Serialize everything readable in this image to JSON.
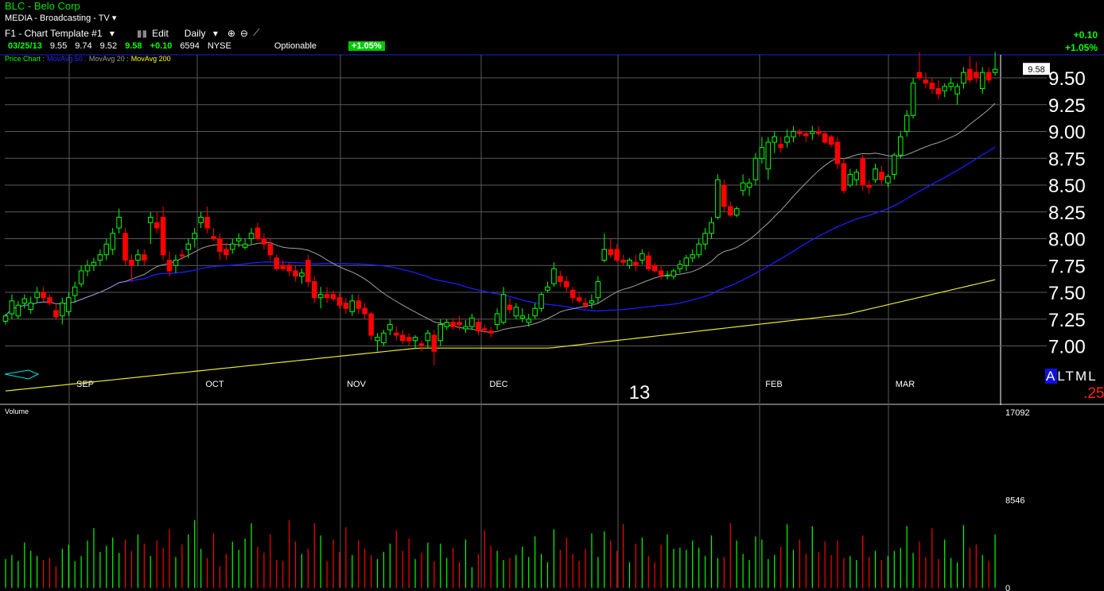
{
  "header": {
    "symbol_title": "BLC - Belo Corp",
    "sector": "MEDIA - Broadcasting - TV",
    "template": "F1 - Chart Template #1",
    "edit_label": "Edit",
    "period": "Daily",
    "optionable": "Optionable",
    "pct_badge": "+1.05%"
  },
  "quote": {
    "date": "03/25/13",
    "open": "9.55",
    "high": "9.74",
    "low": "9.52",
    "last": "9.58",
    "change": "+0.10",
    "volume": "6594",
    "exchange": "NYSE"
  },
  "summary": {
    "change": "+0.10",
    "pct": "+1.05%"
  },
  "legend": [
    {
      "text": "Price Chart :",
      "color": "#00ff00"
    },
    {
      "text": "MovAvg 50 :",
      "color": "#2828ff"
    },
    {
      "text": "MovAvg 20 :",
      "color": "#9a9a9a"
    },
    {
      "text": "MovAvg 200",
      "color": "#ffff00"
    }
  ],
  "colors": {
    "up": "#00ff00",
    "down": "#ff0000",
    "grid": "#5a5a5a",
    "ma20": "#a0a0a0",
    "ma50": "#1c1cff",
    "ma200": "#e8e830",
    "border": "#2020d0"
  },
  "volume_panel": {
    "label": "Volume",
    "ticks": [
      "17092",
      "8546",
      "0"
    ],
    "max": 17092
  },
  "timeframe": {
    "options": [
      "A",
      "L",
      "T",
      "M",
      "L"
    ],
    "selected": "A",
    "offset": ".25"
  },
  "year_label": "13",
  "chart_data": {
    "type": "candlestick",
    "ylim": [
      6.5,
      9.62
    ],
    "y_ticks": [
      "9.50",
      "9.25",
      "9.00",
      "8.75",
      "8.50",
      "8.25",
      "8.00",
      "7.75",
      "7.50",
      "7.25",
      "7.00"
    ],
    "x_ticks": [
      "SEP",
      "OCT",
      "NOV",
      "DEC",
      "FEB",
      "MAR"
    ],
    "last_price_label": "9.58",
    "candles": [
      [
        7.23,
        7.3,
        7.2,
        7.28
      ],
      [
        7.3,
        7.48,
        7.25,
        7.42
      ],
      [
        7.28,
        7.42,
        7.25,
        7.38
      ],
      [
        7.4,
        7.48,
        7.35,
        7.44
      ],
      [
        7.34,
        7.46,
        7.3,
        7.4
      ],
      [
        7.45,
        7.55,
        7.4,
        7.5
      ],
      [
        7.5,
        7.55,
        7.42,
        7.45
      ],
      [
        7.45,
        7.48,
        7.38,
        7.4
      ],
      [
        7.33,
        7.4,
        7.25,
        7.27
      ],
      [
        7.28,
        7.45,
        7.2,
        7.4
      ],
      [
        7.32,
        7.5,
        7.28,
        7.45
      ],
      [
        7.47,
        7.6,
        7.4,
        7.55
      ],
      [
        7.58,
        7.75,
        7.55,
        7.7
      ],
      [
        7.7,
        7.8,
        7.65,
        7.75
      ],
      [
        7.75,
        7.82,
        7.7,
        7.78
      ],
      [
        7.8,
        7.9,
        7.75,
        7.85
      ],
      [
        7.85,
        8.0,
        7.8,
        7.95
      ],
      [
        7.9,
        8.1,
        7.85,
        8.05
      ],
      [
        8.1,
        8.28,
        8.05,
        8.2
      ],
      [
        8.05,
        8.1,
        7.75,
        7.8
      ],
      [
        7.8,
        7.85,
        7.6,
        7.75
      ],
      [
        7.8,
        7.9,
        7.75,
        7.85
      ],
      [
        7.85,
        7.9,
        7.75,
        7.8
      ],
      [
        8.15,
        8.25,
        7.95,
        8.2
      ],
      [
        8.15,
        8.25,
        8.05,
        8.1
      ],
      [
        8.2,
        8.3,
        7.8,
        7.85
      ],
      [
        7.8,
        7.88,
        7.65,
        7.7
      ],
      [
        7.75,
        7.85,
        7.68,
        7.8
      ],
      [
        7.85,
        7.9,
        7.8,
        7.84
      ],
      [
        7.9,
        8.0,
        7.82,
        7.95
      ],
      [
        8.0,
        8.1,
        7.92,
        8.05
      ],
      [
        8.15,
        8.25,
        8.1,
        8.2
      ],
      [
        8.2,
        8.3,
        8.05,
        8.1
      ],
      [
        8.02,
        8.1,
        7.98,
        8.0
      ],
      [
        8.0,
        8.05,
        7.8,
        7.88
      ],
      [
        7.9,
        7.96,
        7.8,
        7.85
      ],
      [
        7.9,
        8.0,
        7.86,
        7.95
      ],
      [
        7.98,
        8.05,
        7.92,
        8.0
      ],
      [
        7.92,
        8.0,
        7.9,
        7.95
      ],
      [
        8.0,
        8.1,
        7.95,
        8.05
      ],
      [
        8.1,
        8.15,
        7.98,
        8.0
      ],
      [
        8.0,
        8.05,
        7.9,
        7.95
      ],
      [
        7.95,
        8.0,
        7.8,
        7.85
      ],
      [
        7.82,
        7.85,
        7.7,
        7.72
      ],
      [
        7.75,
        7.8,
        7.7,
        7.72
      ],
      [
        7.75,
        7.78,
        7.65,
        7.7
      ],
      [
        7.7,
        7.75,
        7.6,
        7.65
      ],
      [
        7.65,
        7.72,
        7.58,
        7.68
      ],
      [
        7.8,
        7.85,
        7.55,
        7.6
      ],
      [
        7.6,
        7.65,
        7.4,
        7.45
      ],
      [
        7.45,
        7.55,
        7.35,
        7.48
      ],
      [
        7.48,
        7.55,
        7.4,
        7.45
      ],
      [
        7.48,
        7.52,
        7.42,
        7.44
      ],
      [
        7.45,
        7.5,
        7.35,
        7.38
      ],
      [
        7.4,
        7.45,
        7.3,
        7.35
      ],
      [
        7.32,
        7.48,
        7.28,
        7.42
      ],
      [
        7.42,
        7.48,
        7.3,
        7.35
      ],
      [
        7.35,
        7.4,
        7.25,
        7.3
      ],
      [
        7.3,
        7.32,
        7.05,
        7.1
      ],
      [
        7.05,
        7.12,
        6.95,
        7.08
      ],
      [
        7.03,
        7.15,
        7.0,
        7.12
      ],
      [
        7.15,
        7.25,
        7.1,
        7.2
      ],
      [
        7.12,
        7.18,
        7.05,
        7.1
      ],
      [
        7.1,
        7.15,
        7.02,
        7.05
      ],
      [
        7.08,
        7.12,
        7.0,
        7.05
      ],
      [
        7.05,
        7.1,
        6.98,
        7.08
      ],
      [
        7.02,
        7.05,
        6.95,
        7.0
      ],
      [
        7.05,
        7.15,
        6.98,
        7.12
      ],
      [
        7.1,
        7.15,
        6.82,
        6.95
      ],
      [
        7.05,
        7.25,
        7.0,
        7.2
      ],
      [
        7.18,
        7.25,
        7.15,
        7.22
      ],
      [
        7.22,
        7.26,
        7.15,
        7.18
      ],
      [
        7.22,
        7.28,
        7.15,
        7.2
      ],
      [
        7.16,
        7.24,
        7.12,
        7.18
      ],
      [
        7.18,
        7.3,
        7.15,
        7.26
      ],
      [
        7.22,
        7.25,
        7.1,
        7.14
      ],
      [
        7.16,
        7.2,
        7.12,
        7.15
      ],
      [
        7.14,
        7.18,
        7.08,
        7.12
      ],
      [
        7.2,
        7.35,
        7.15,
        7.3
      ],
      [
        7.22,
        7.55,
        7.2,
        7.48
      ],
      [
        7.38,
        7.45,
        7.3,
        7.34
      ],
      [
        7.28,
        7.4,
        7.25,
        7.36
      ],
      [
        7.26,
        7.35,
        7.22,
        7.28
      ],
      [
        7.22,
        7.3,
        7.18,
        7.25
      ],
      [
        7.28,
        7.4,
        7.25,
        7.35
      ],
      [
        7.35,
        7.5,
        7.32,
        7.48
      ],
      [
        7.52,
        7.6,
        7.5,
        7.55
      ],
      [
        7.58,
        7.78,
        7.55,
        7.72
      ],
      [
        7.65,
        7.7,
        7.55,
        7.6
      ],
      [
        7.6,
        7.65,
        7.5,
        7.55
      ],
      [
        7.52,
        7.55,
        7.4,
        7.45
      ],
      [
        7.45,
        7.5,
        7.4,
        7.42
      ],
      [
        7.4,
        7.45,
        7.35,
        7.38
      ],
      [
        7.4,
        7.48,
        7.35,
        7.42
      ],
      [
        7.45,
        7.65,
        7.4,
        7.6
      ],
      [
        7.8,
        8.05,
        7.78,
        7.9
      ],
      [
        7.9,
        8.0,
        7.82,
        7.85
      ],
      [
        7.9,
        7.95,
        7.78,
        7.8
      ],
      [
        7.8,
        7.85,
        7.75,
        7.78
      ],
      [
        7.75,
        7.82,
        7.72,
        7.8
      ],
      [
        7.78,
        7.85,
        7.7,
        7.75
      ],
      [
        7.8,
        7.9,
        7.76,
        7.86
      ],
      [
        7.84,
        7.88,
        7.7,
        7.72
      ],
      [
        7.75,
        7.78,
        7.68,
        7.7
      ],
      [
        7.7,
        7.75,
        7.62,
        7.66
      ],
      [
        7.66,
        7.7,
        7.62,
        7.66
      ],
      [
        7.65,
        7.72,
        7.62,
        7.7
      ],
      [
        7.72,
        7.8,
        7.68,
        7.76
      ],
      [
        7.75,
        7.85,
        7.7,
        7.82
      ],
      [
        7.82,
        7.9,
        7.78,
        7.85
      ],
      [
        7.85,
        8.0,
        7.82,
        7.95
      ],
      [
        7.95,
        8.1,
        7.9,
        8.05
      ],
      [
        8.05,
        8.2,
        8.0,
        8.15
      ],
      [
        8.2,
        8.6,
        8.18,
        8.55
      ],
      [
        8.5,
        8.55,
        8.25,
        8.3
      ],
      [
        8.3,
        8.35,
        8.2,
        8.22
      ],
      [
        8.22,
        8.3,
        8.2,
        8.28
      ],
      [
        8.45,
        8.6,
        8.4,
        8.52
      ],
      [
        8.48,
        8.56,
        8.4,
        8.52
      ],
      [
        8.55,
        8.8,
        8.5,
        8.75
      ],
      [
        8.75,
        8.95,
        8.7,
        8.85
      ],
      [
        8.65,
        8.95,
        8.55,
        8.9
      ],
      [
        8.9,
        9.0,
        8.8,
        8.95
      ],
      [
        8.88,
        8.95,
        8.8,
        8.85
      ],
      [
        8.9,
        9.02,
        8.85,
        8.95
      ],
      [
        8.95,
        9.05,
        8.9,
        9.0
      ],
      [
        9.0,
        9.02,
        8.95,
        8.98
      ],
      [
        8.98,
        9.0,
        8.9,
        8.96
      ],
      [
        8.98,
        9.05,
        8.92,
        9.0
      ],
      [
        9.0,
        9.05,
        8.95,
        8.98
      ],
      [
        8.98,
        9.0,
        8.88,
        8.9
      ],
      [
        8.95,
        8.97,
        8.85,
        8.88
      ],
      [
        8.9,
        8.95,
        8.65,
        8.7
      ],
      [
        8.7,
        8.75,
        8.42,
        8.45
      ],
      [
        8.5,
        8.65,
        8.48,
        8.6
      ],
      [
        8.55,
        8.65,
        8.5,
        8.62
      ],
      [
        8.75,
        8.78,
        8.45,
        8.5
      ],
      [
        8.5,
        8.55,
        8.42,
        8.48
      ],
      [
        8.55,
        8.7,
        8.52,
        8.65
      ],
      [
        8.62,
        8.68,
        8.5,
        8.55
      ],
      [
        8.52,
        8.6,
        8.48,
        8.58
      ],
      [
        8.6,
        8.8,
        8.55,
        8.78
      ],
      [
        8.78,
        9.0,
        8.75,
        8.95
      ],
      [
        9.0,
        9.2,
        8.95,
        9.15
      ],
      [
        9.15,
        9.5,
        9.12,
        9.45
      ],
      [
        9.55,
        9.74,
        9.48,
        9.5
      ],
      [
        9.48,
        9.55,
        9.4,
        9.45
      ],
      [
        9.45,
        9.5,
        9.35,
        9.4
      ],
      [
        9.4,
        9.48,
        9.3,
        9.35
      ],
      [
        9.38,
        9.45,
        9.32,
        9.42
      ],
      [
        9.42,
        9.5,
        9.38,
        9.45
      ],
      [
        9.35,
        9.45,
        9.25,
        9.42
      ],
      [
        9.45,
        9.6,
        9.4,
        9.55
      ],
      [
        9.58,
        9.7,
        9.45,
        9.48
      ],
      [
        9.55,
        9.65,
        9.45,
        9.5
      ],
      [
        9.4,
        9.6,
        9.35,
        9.55
      ],
      [
        9.55,
        9.6,
        9.45,
        9.48
      ],
      [
        9.55,
        9.74,
        9.52,
        9.58
      ]
    ],
    "volume": [
      2800,
      3200,
      2600,
      4400,
      3600,
      3100,
      2700,
      2900,
      2100,
      3800,
      4200,
      2600,
      3100,
      4600,
      5800,
      3500,
      4100,
      4900,
      3400,
      4700,
      3600,
      5200,
      4300,
      3100,
      4600,
      3900,
      5700,
      3000,
      4200,
      5200,
      6600,
      3800,
      2900,
      5300,
      2100,
      3300,
      4500,
      3700,
      4800,
      6300,
      4000,
      3400,
      5200,
      2700,
      2600,
      6600,
      4500,
      3300,
      3800,
      6300,
      5100,
      2600,
      4700,
      3500,
      5900,
      3200,
      4600,
      3800,
      3200,
      2800,
      3500,
      4300,
      5600,
      3600,
      4800,
      2800,
      3400,
      4400,
      2600,
      4300,
      2900,
      3900,
      2500,
      4700,
      2000,
      3300,
      5600,
      4100,
      3600,
      2700,
      2900,
      3200,
      4000,
      3000,
      5000,
      3300,
      2500,
      5700,
      3700,
      4900,
      3300,
      2600,
      3800,
      5300,
      3000,
      5500,
      4600,
      3600,
      6200,
      2500,
      4300,
      4900,
      3100,
      2500,
      4200,
      5200,
      3800,
      3900,
      3700,
      4600,
      3900,
      3100,
      5100,
      2900,
      3000,
      6300,
      4600,
      3300,
      2700,
      5000,
      4700,
      2800,
      3200,
      4000,
      6200,
      3700,
      4700,
      3300,
      6000,
      3500,
      4500,
      3200,
      4600,
      2900,
      3100,
      2700,
      5100,
      3000,
      3600,
      2700,
      3100,
      3600,
      3900,
      6000,
      3400,
      4500,
      3000,
      5800,
      2800,
      4700,
      2900,
      2500,
      6100,
      3900,
      4200,
      3200,
      2600,
      5200,
      3500,
      4400,
      4100,
      2800,
      4300,
      2500,
      3500,
      3000,
      3700,
      3400,
      3200,
      3600
    ]
  }
}
